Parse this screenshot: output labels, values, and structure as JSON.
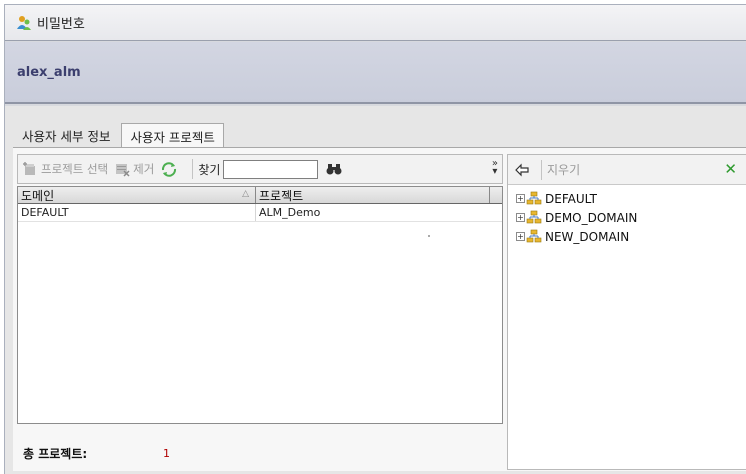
{
  "window": {
    "title": "비밀번호",
    "icon": "users-icon"
  },
  "user": {
    "name": "alex_alm"
  },
  "tabs": [
    {
      "label": "사용자 세부 정보",
      "active": false
    },
    {
      "label": "사용자 프로젝트",
      "active": true
    }
  ],
  "toolbar": {
    "select_project_label": "프로젝트 선택",
    "remove_label": "제거",
    "find_label": "찾기",
    "find_value": ""
  },
  "grid": {
    "columns": [
      "도메인",
      "프로젝트"
    ],
    "rows": [
      {
        "domain": "DEFAULT",
        "project": "ALM_Demo"
      }
    ]
  },
  "status": {
    "total_label": "총 프로젝트:",
    "total_value": "1"
  },
  "right_panel": {
    "clear_label": "지우기",
    "tree": [
      {
        "label": "DEFAULT"
      },
      {
        "label": "DEMO_DOMAIN"
      },
      {
        "label": "NEW_DOMAIN"
      }
    ]
  },
  "colors": {
    "accent_green": "#2e9a2e",
    "count_red": "#b00000",
    "user_text": "#3c3f6e"
  }
}
